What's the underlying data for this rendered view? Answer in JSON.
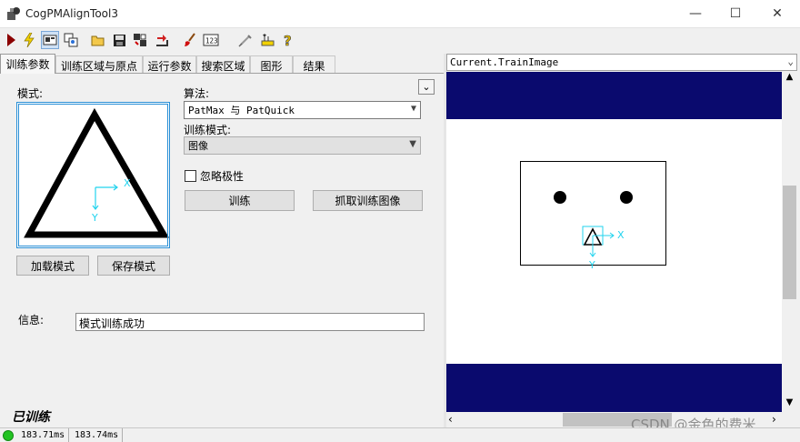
{
  "window": {
    "title": "CogPMAlignTool3",
    "minimize_glyph": "—",
    "maximize_glyph": "☐",
    "close_glyph": "✕"
  },
  "toolbar": {
    "buttons": [
      "run-icon",
      "electric-icon",
      "display-icon",
      "copy-images-icon",
      "open-icon",
      "save-icon",
      "reset-icon",
      "import-icon",
      "brush-icon",
      "numeric-icon",
      "pen-icon",
      "ruler-icon",
      "help-icon"
    ]
  },
  "tabs": [
    "训练参数",
    "训练区域与原点",
    "运行参数",
    "搜索区域",
    "图形",
    "结果"
  ],
  "panel": {
    "pattern_label": "模式:",
    "algorithm_label": "算法:",
    "algorithm_value": "PatMax 与 PatQuick",
    "train_mode_label": "训练模式:",
    "train_mode_value": "图像",
    "ignore_polarity_label": "忽略极性",
    "ignore_polarity_checked": false,
    "train_button": "训练",
    "grab_train_image_button": "抓取训练图像",
    "load_pattern_button": "加载模式",
    "save_pattern_button": "保存模式",
    "info_label": "信息:",
    "info_value": "模式训练成功",
    "trained_status": "已训练",
    "collapse_glyph": "⌄",
    "pattern_axis_x": "X",
    "pattern_axis_y": "Y"
  },
  "image_display": {
    "selector": "Current.TrainImage",
    "axis_x": "X",
    "axis_y": "Y"
  },
  "statusbar": {
    "time1": "183.71ms",
    "time2": "183.74ms",
    "status_color": "#22c322"
  },
  "watermark": "CSDN @金色的费米",
  "colors": {
    "navy": "#0a0a6e",
    "cyan": "#22d3ee",
    "pattern_border": "#2a8fd6"
  }
}
